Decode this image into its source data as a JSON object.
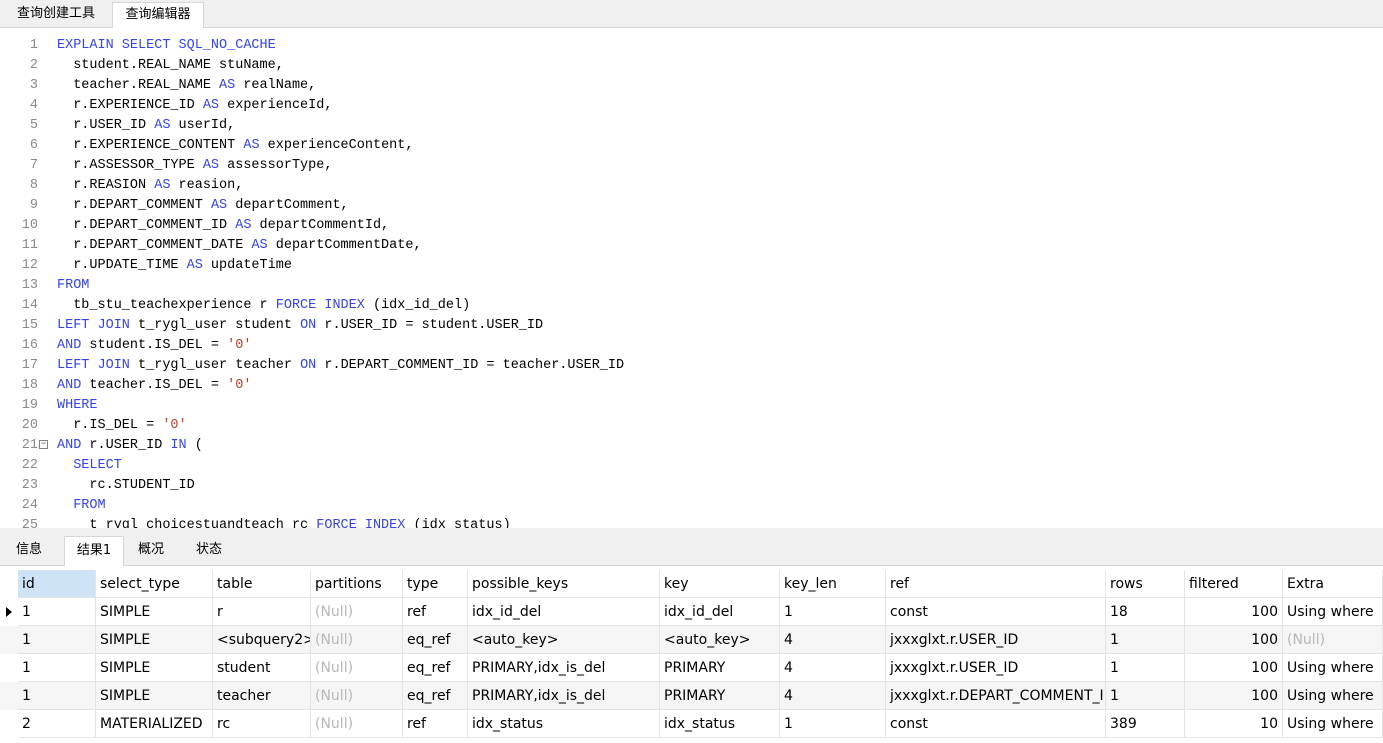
{
  "top_tabs": [
    "查询创建工具",
    "查询编辑器"
  ],
  "editor_lines": [
    [
      [
        "kw",
        "EXPLAIN SELECT SQL_NO_CACHE"
      ]
    ],
    [
      [
        "id",
        "  student.REAL_NAME stuName,"
      ]
    ],
    [
      [
        "id",
        "  teacher.REAL_NAME "
      ],
      [
        "kw",
        "AS"
      ],
      [
        "id",
        " realName,"
      ]
    ],
    [
      [
        "id",
        "  r.EXPERIENCE_ID "
      ],
      [
        "kw",
        "AS"
      ],
      [
        "id",
        " experienceId,"
      ]
    ],
    [
      [
        "id",
        "  r.USER_ID "
      ],
      [
        "kw",
        "AS"
      ],
      [
        "id",
        " userId,"
      ]
    ],
    [
      [
        "id",
        "  r.EXPERIENCE_CONTENT "
      ],
      [
        "kw",
        "AS"
      ],
      [
        "id",
        " experienceContent,"
      ]
    ],
    [
      [
        "id",
        "  r.ASSESSOR_TYPE "
      ],
      [
        "kw",
        "AS"
      ],
      [
        "id",
        " assessorType,"
      ]
    ],
    [
      [
        "id",
        "  r.REASION "
      ],
      [
        "kw",
        "AS"
      ],
      [
        "id",
        " reasion,"
      ]
    ],
    [
      [
        "id",
        "  r.DEPART_COMMENT "
      ],
      [
        "kw",
        "AS"
      ],
      [
        "id",
        " departComment,"
      ]
    ],
    [
      [
        "id",
        "  r.DEPART_COMMENT_ID "
      ],
      [
        "kw",
        "AS"
      ],
      [
        "id",
        " departCommentId,"
      ]
    ],
    [
      [
        "id",
        "  r.DEPART_COMMENT_DATE "
      ],
      [
        "kw",
        "AS"
      ],
      [
        "id",
        " departCommentDate,"
      ]
    ],
    [
      [
        "id",
        "  r.UPDATE_TIME "
      ],
      [
        "kw",
        "AS"
      ],
      [
        "id",
        " updateTime"
      ]
    ],
    [
      [
        "kw",
        "FROM"
      ]
    ],
    [
      [
        "id",
        "  tb_stu_teachexperience r "
      ],
      [
        "kw",
        "FORCE INDEX"
      ],
      [
        "id",
        " (idx_id_del)"
      ]
    ],
    [
      [
        "kw",
        "LEFT JOIN"
      ],
      [
        "id",
        " t_rygl_user student "
      ],
      [
        "kw",
        "ON"
      ],
      [
        "id",
        " r.USER_ID = student.USER_ID"
      ]
    ],
    [
      [
        "kw",
        "AND"
      ],
      [
        "id",
        " student.IS_DEL = "
      ],
      [
        "str",
        "'0'"
      ]
    ],
    [
      [
        "kw",
        "LEFT JOIN"
      ],
      [
        "id",
        " t_rygl_user teacher "
      ],
      [
        "kw",
        "ON"
      ],
      [
        "id",
        " r.DEPART_COMMENT_ID = teacher.USER_ID"
      ]
    ],
    [
      [
        "kw",
        "AND"
      ],
      [
        "id",
        " teacher.IS_DEL = "
      ],
      [
        "str",
        "'0'"
      ]
    ],
    [
      [
        "kw",
        "WHERE"
      ]
    ],
    [
      [
        "id",
        "  r.IS_DEL = "
      ],
      [
        "str",
        "'0'"
      ]
    ],
    [
      [
        "kw",
        "AND"
      ],
      [
        "id",
        " r.USER_ID "
      ],
      [
        "kw",
        "IN"
      ],
      [
        "id",
        " ("
      ]
    ],
    [
      [
        "kw",
        "  SELECT"
      ]
    ],
    [
      [
        "id",
        "    rc.STUDENT_ID"
      ]
    ],
    [
      [
        "kw",
        "  FROM"
      ]
    ],
    [
      [
        "id",
        "    t_rygl_choicestuandteach rc "
      ],
      [
        "kw",
        "FORCE INDEX"
      ],
      [
        "id",
        " (idx_status)"
      ]
    ]
  ],
  "fold_marker": "−",
  "bottom_tabs": [
    "信息",
    "结果1",
    "概况",
    "状态"
  ],
  "grid": {
    "columns": [
      "id",
      "select_type",
      "table",
      "partitions",
      "type",
      "possible_keys",
      "key",
      "key_len",
      "ref",
      "rows",
      "filtered",
      "Extra"
    ],
    "rows": [
      [
        "1",
        "SIMPLE",
        "r",
        "(Null)",
        "ref",
        "idx_id_del",
        "idx_id_del",
        "1",
        "const",
        "18",
        "100",
        "Using where"
      ],
      [
        "1",
        "SIMPLE",
        "<subquery2>",
        "(Null)",
        "eq_ref",
        "<auto_key>",
        "<auto_key>",
        "4",
        "jxxxglxt.r.USER_ID",
        "1",
        "100",
        "(Null)"
      ],
      [
        "1",
        "SIMPLE",
        "student",
        "(Null)",
        "eq_ref",
        "PRIMARY,idx_is_del",
        "PRIMARY",
        "4",
        "jxxxglxt.r.USER_ID",
        "1",
        "100",
        "Using where"
      ],
      [
        "1",
        "SIMPLE",
        "teacher",
        "(Null)",
        "eq_ref",
        "PRIMARY,idx_is_del",
        "PRIMARY",
        "4",
        "jxxxglxt.r.DEPART_COMMENT_ID",
        "1",
        "100",
        "Using where"
      ],
      [
        "2",
        "MATERIALIZED",
        "rc",
        "(Null)",
        "ref",
        "idx_status",
        "idx_status",
        "1",
        "const",
        "389",
        "10",
        "Using where"
      ]
    ]
  },
  "colors": {
    "keyword": "#3344ee",
    "string": "#c0392b",
    "null": "#b8b8b8",
    "header_selected": "#cfe3f7"
  }
}
